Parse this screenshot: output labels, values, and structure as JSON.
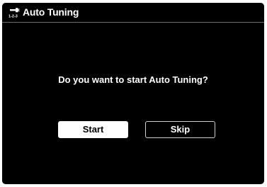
{
  "header": {
    "title": "Auto Tuning",
    "icon": "auto-tuning-wrench-icon",
    "icon_sublabel": "1-2-3"
  },
  "dialog": {
    "prompt": "Do you want to start Auto Tuning?",
    "start_label": "Start",
    "skip_label": "Skip"
  },
  "colors": {
    "background": "#000000",
    "text": "#ffffff",
    "selected_button_bg": "#ffffff",
    "selected_button_text": "#000000",
    "divider": "#6e6e6e"
  }
}
